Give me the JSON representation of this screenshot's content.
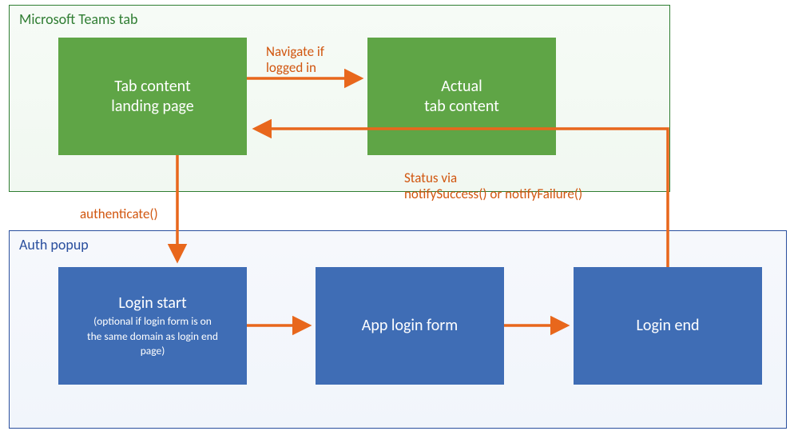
{
  "diagram": {
    "frames": {
      "teams": {
        "label": "Microsoft Teams tab",
        "border_color": "#2f7d32"
      },
      "auth": {
        "label": "Auth popup",
        "border_color": "#2a4f9e"
      }
    },
    "nodes": {
      "landing": {
        "title_line1": "Tab content",
        "title_line2": "landing page",
        "color": "#5fa546"
      },
      "actual": {
        "title_line1": "Actual",
        "title_line2": "tab content",
        "color": "#5fa546"
      },
      "login_start": {
        "title": "Login start",
        "sub_line1": "(optional if login form is on",
        "sub_line2": "the same domain as login end",
        "sub_line3": "page)",
        "color": "#3f6db5"
      },
      "login_form": {
        "title": "App login form",
        "color": "#3f6db5"
      },
      "login_end": {
        "title": "Login end",
        "color": "#3f6db5"
      }
    },
    "edges": {
      "navigate": {
        "line1": "Navigate if",
        "line2": "logged in"
      },
      "authenticate": {
        "label": "authenticate()"
      },
      "status": {
        "line1": "Status via",
        "line2": "notifySuccess() or notifyFailure()"
      }
    },
    "colors": {
      "arrow": "#e8671c",
      "node_green": "#5fa546",
      "node_blue": "#3f6db5"
    }
  },
  "chart_data": {
    "type": "flow-diagram",
    "containers": [
      {
        "id": "teams",
        "label": "Microsoft Teams tab",
        "contains": [
          "landing",
          "actual"
        ]
      },
      {
        "id": "auth",
        "label": "Auth popup",
        "contains": [
          "login_start",
          "login_form",
          "login_end"
        ]
      }
    ],
    "nodes": [
      {
        "id": "landing",
        "label": "Tab content landing page",
        "group": "teams",
        "color": "#5fa546"
      },
      {
        "id": "actual",
        "label": "Actual tab content",
        "group": "teams",
        "color": "#5fa546"
      },
      {
        "id": "login_start",
        "label": "Login start (optional if login form is on the same domain as login end page)",
        "group": "auth",
        "color": "#3f6db5"
      },
      {
        "id": "login_form",
        "label": "App login form",
        "group": "auth",
        "color": "#3f6db5"
      },
      {
        "id": "login_end",
        "label": "Login end",
        "group": "auth",
        "color": "#3f6db5"
      }
    ],
    "edges": [
      {
        "from": "landing",
        "to": "actual",
        "label": "Navigate if logged in"
      },
      {
        "from": "landing",
        "to": "login_start",
        "label": "authenticate()"
      },
      {
        "from": "login_start",
        "to": "login_form",
        "label": ""
      },
      {
        "from": "login_form",
        "to": "login_end",
        "label": ""
      },
      {
        "from": "login_end",
        "to": "landing",
        "label": "Status via notifySuccess() or notifyFailure()"
      }
    ]
  }
}
